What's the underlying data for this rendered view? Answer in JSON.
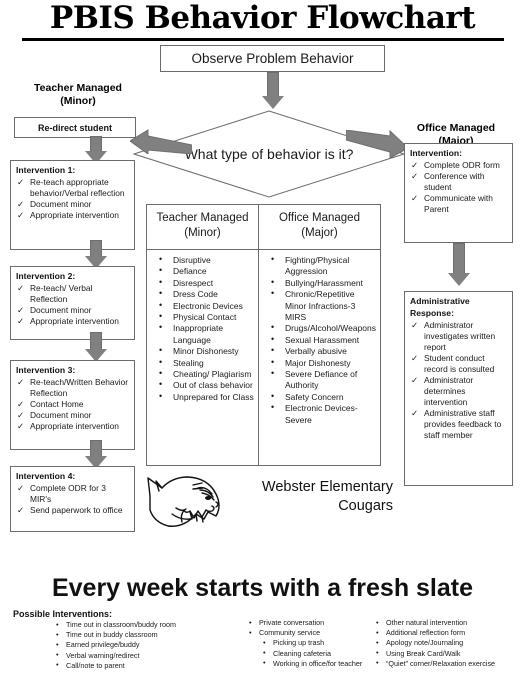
{
  "title": "PBIS Behavior Flowchart",
  "observe": {
    "label": "Observe Problem Behavior"
  },
  "decision": {
    "question": "What type of behavior is it?"
  },
  "left_branch": {
    "label_line1": "Teacher Managed",
    "label_line2": "(Minor)",
    "redirect": "Re-direct student",
    "interventions": [
      {
        "title": "Intervention 1:",
        "items": [
          "Re-teach appropriate behavior/Verbal reflection",
          "Document minor",
          "Appropriate intervention"
        ]
      },
      {
        "title": "Intervention 2:",
        "items": [
          "Re-teach/ Verbal Reflection",
          "Document minor",
          "Appropriate intervention"
        ]
      },
      {
        "title": "Intervention 3:",
        "items": [
          "Re-teach/Written Behavior Reflection",
          "Contact Home",
          "Document minor",
          "Appropriate intervention"
        ]
      },
      {
        "title": "Intervention 4:",
        "items": [
          "Complete ODR for 3 MIR's",
          "Send paperwork to office"
        ]
      }
    ]
  },
  "right_branch": {
    "label_line1": "Office Managed",
    "label_line2": "(Major)",
    "intervention": {
      "title": "Intervention:",
      "items": [
        "Complete ODR form",
        "Conference with student",
        "Communicate with Parent"
      ]
    },
    "administrative": {
      "title_line1": "Administrative",
      "title_line2": "Response:",
      "items": [
        "Administrator investigates written report",
        "Student conduct record is consulted",
        "Administrator determines intervention",
        "Administrative staff provides feedback to staff member"
      ]
    }
  },
  "behavior_table": {
    "teacher": {
      "header_line1": "Teacher Managed",
      "header_line2": "(Minor)",
      "items": [
        "Disruptive",
        "Defiance",
        "Disrespect",
        "Dress Code",
        "Electronic Devices",
        "Physical Contact",
        "Inappropriate Language",
        "Minor Dishonesty",
        "Stealing",
        "Cheating/ Plagiarism",
        "Out of class behavior",
        "Unprepared for Class"
      ]
    },
    "office": {
      "header_line1": "Office Managed",
      "header_line2": "(Major)",
      "items": [
        "Fighting/Physical Aggression",
        "Bullying/Harassment",
        "Chronic/Repetitive Minor Infractions-3 MIRS",
        "Drugs/Alcohol/Weapons",
        "Sexual Harassment",
        "Verbally abusive",
        "Major Dishonesty",
        "Severe Defiance of Authority",
        "Safety Concern",
        "Electronic Devices-Severe"
      ]
    }
  },
  "school": {
    "name_line1": "Webster Elementary",
    "name_line2": "Cougars",
    "mascot": "cougar-head-logo"
  },
  "footer": {
    "slogan": "Every week starts with a fresh slate",
    "possible_label": "Possible Interventions:",
    "column1": [
      "Time out in classroom/buddy room",
      "Time out in buddy classroom",
      "Earned privilege/buddy",
      "Verbal warning/redirect",
      "Call/note to parent"
    ],
    "column2": [
      "Private conversation",
      "Community service"
    ],
    "column2_sub": [
      "Picking up trash",
      "Cleaning cafeteria",
      "Working in office/for teacher"
    ],
    "column3": [
      "Other natural intervention",
      "Additional reflection form",
      "Apology note/Journaling",
      "Using Break Card/Walk",
      "“Quiet” corner/Relaxation exercise"
    ]
  },
  "colors": {
    "arrow_fill": "#808080",
    "border": "#6b6b6b",
    "text": "#111111"
  },
  "glyphs": {
    "check": "✓",
    "bullet": "•"
  }
}
